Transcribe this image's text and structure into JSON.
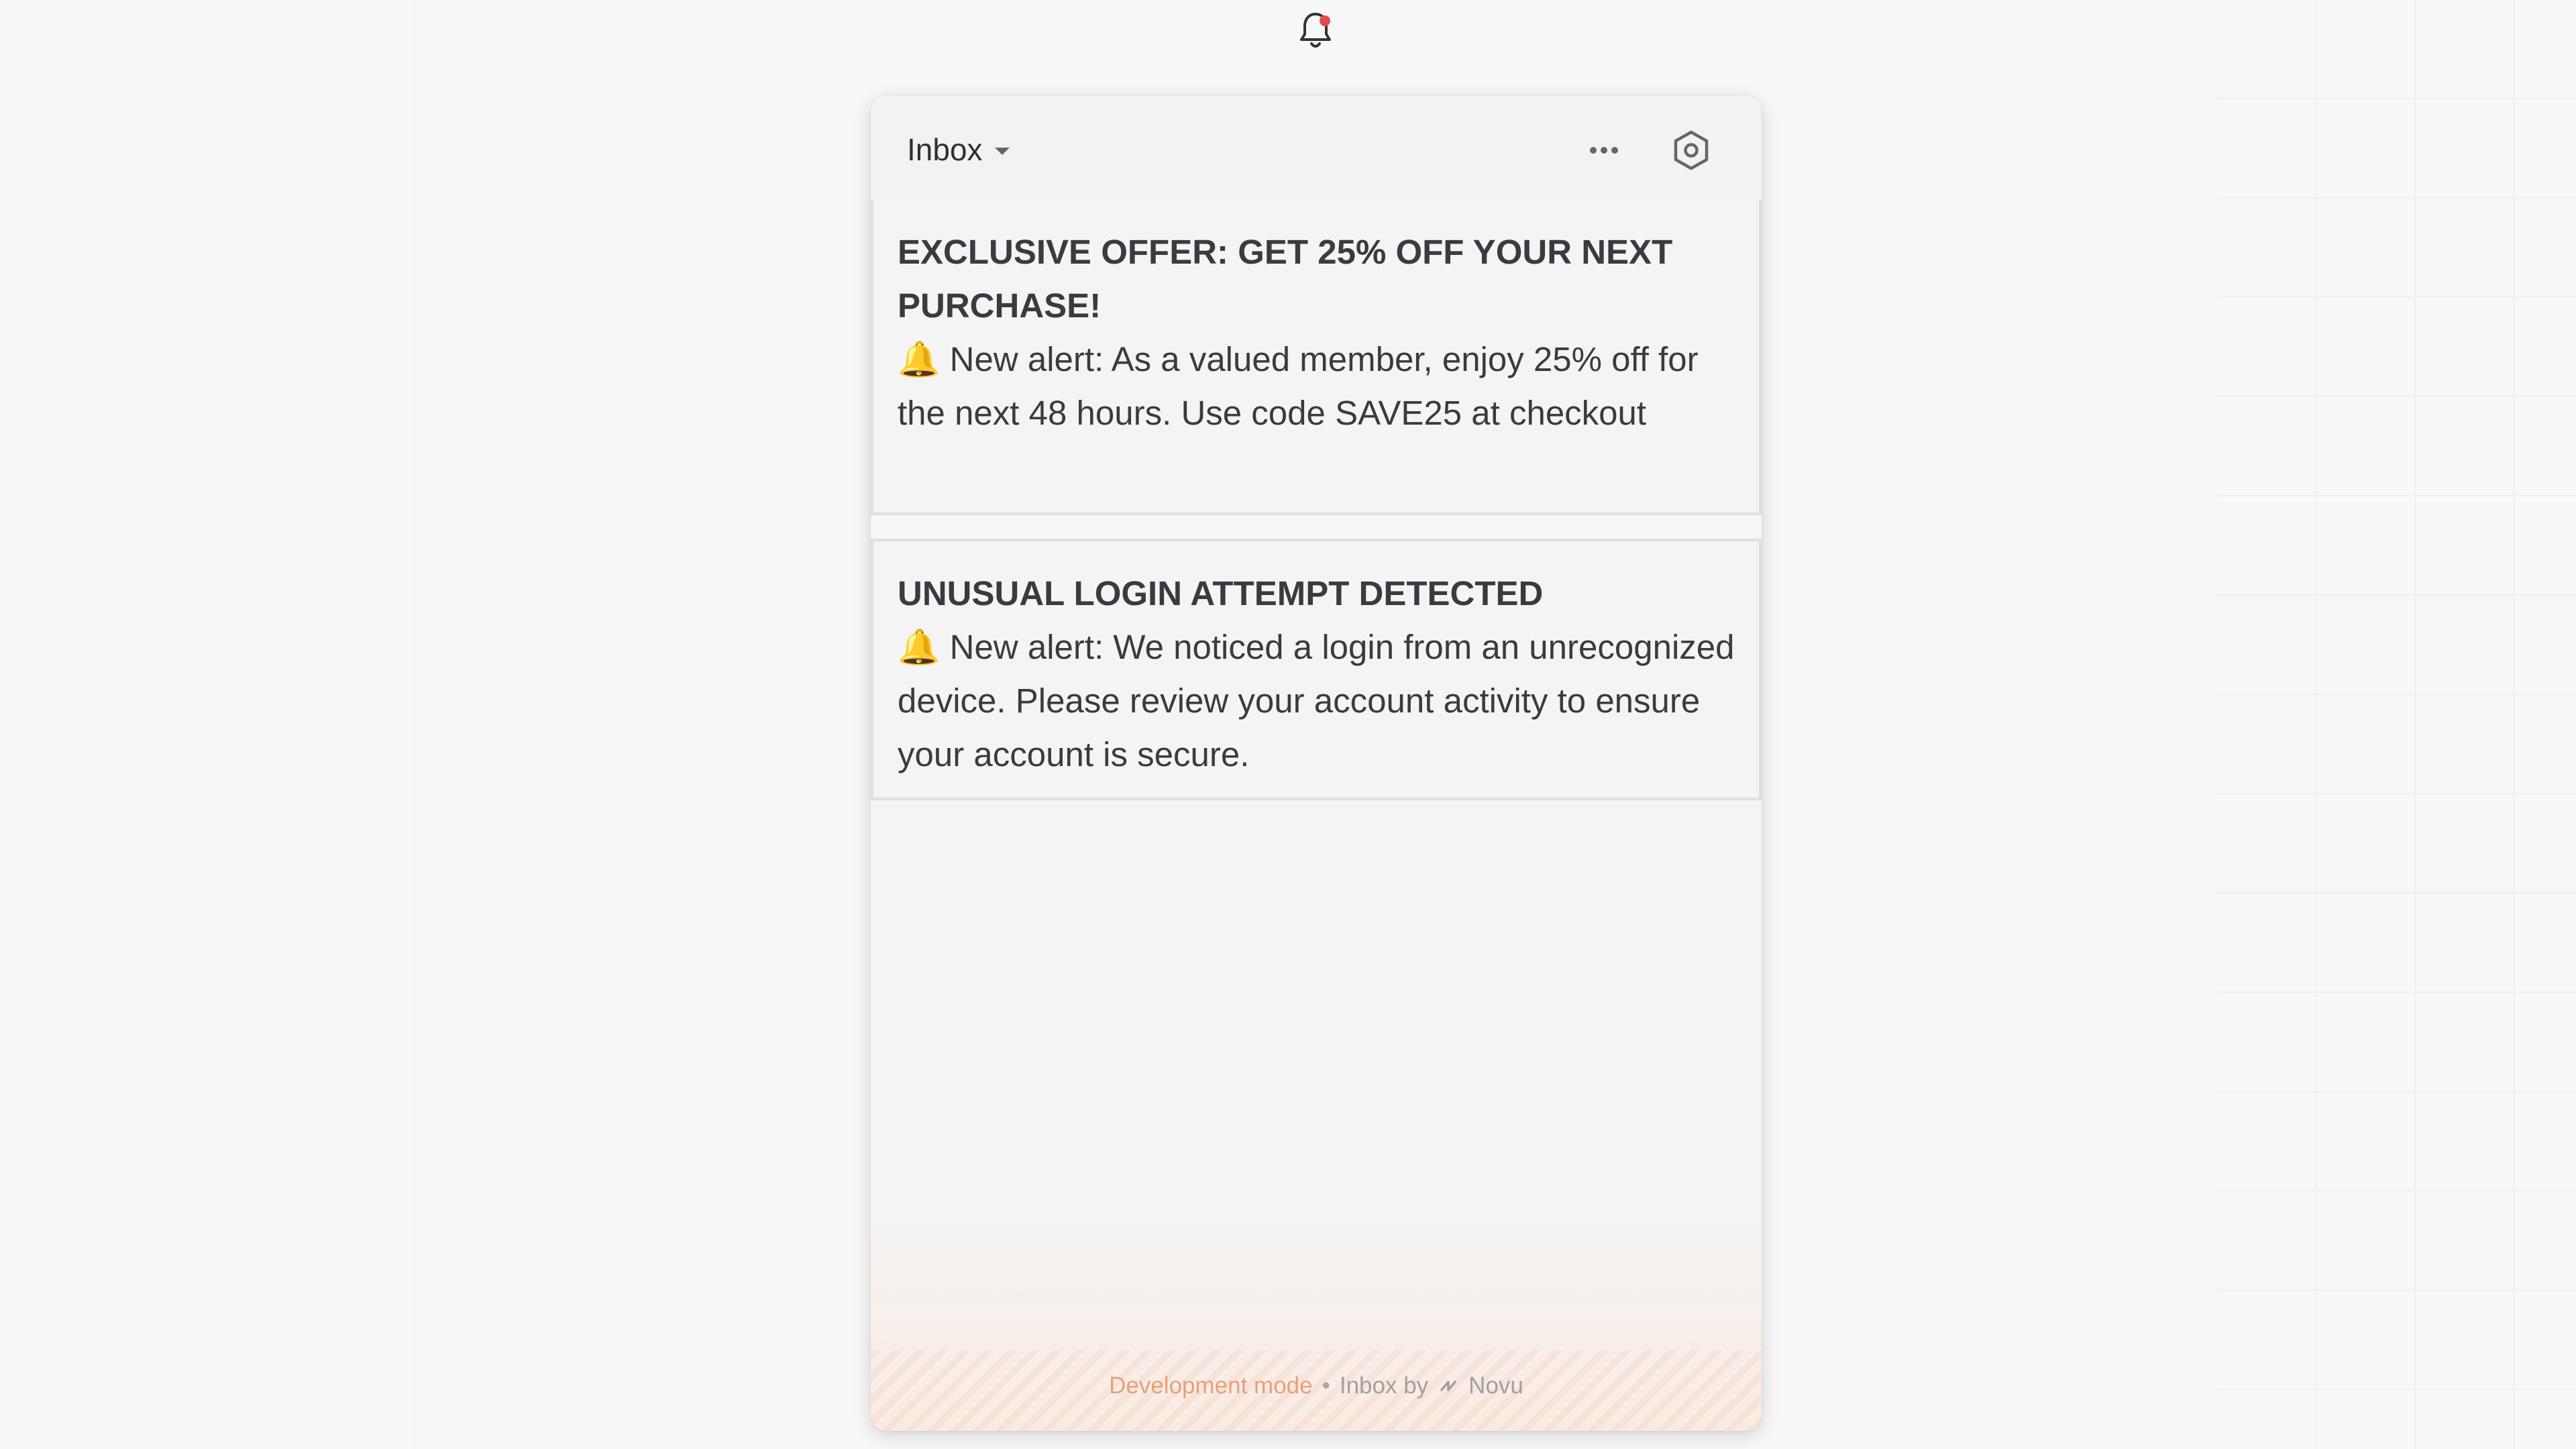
{
  "bell": {
    "has_unread": true,
    "accent": "#e5484d"
  },
  "header": {
    "title": "Inbox",
    "more_icon": "ellipsis-icon",
    "settings_icon": "settings-hexagon-icon"
  },
  "notifications": [
    {
      "title": "EXCLUSIVE OFFER: GET 25% OFF YOUR NEXT PURCHASE!",
      "body": "🔔 New alert: As a valued member, enjoy 25% off for the next 48 hours. Use code SAVE25 at checkout"
    },
    {
      "title": "UNUSUAL LOGIN ATTEMPT DETECTED",
      "body": "🔔 New alert: We noticed a login from an unrecognized device. Please review your account activity to ensure your account is secure."
    }
  ],
  "footer": {
    "dev_mode": "Development mode",
    "separator": "•",
    "powered_by": "Inbox by",
    "brand": "Novu",
    "dev_color": "#e8a07a"
  }
}
